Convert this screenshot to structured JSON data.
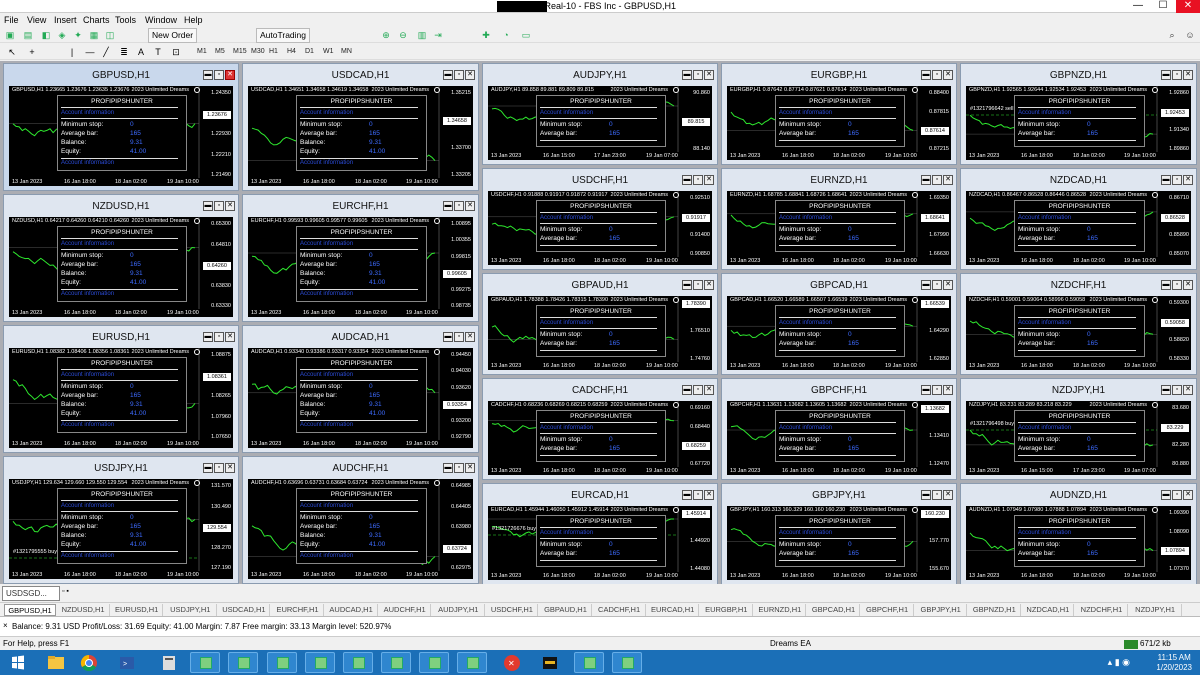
{
  "window": {
    "title": "FBS-Real-10 - FBS Inc - GBPUSD,H1",
    "min": "—",
    "max": "☐",
    "close": "✕"
  },
  "menu": [
    "File",
    "View",
    "Insert",
    "Charts",
    "Tools",
    "Window",
    "Help"
  ],
  "toolbar": {
    "new_order": "New Order",
    "autotrading": "AutoTrading",
    "timeframes": [
      "M1",
      "M5",
      "M15",
      "M30",
      "H1",
      "H4",
      "D1",
      "W1",
      "MN"
    ]
  },
  "ea": {
    "name": "PROFIPIPSHUNTER",
    "min_stop": "Minimum stop:",
    "avg_bar": "Average bar:",
    "balance": "Balance:",
    "equity": "Equity:",
    "link": "Account information",
    "dreams": "2023 Unlimited Dreams"
  },
  "charts": [
    {
      "title": "GBPUSD,H1",
      "header": "GBPUSD,H1  1.23665 1.23676 1.23635 1.23676",
      "prices": [
        "1.24350",
        "1.23676",
        "1.22930",
        "1.22210",
        "1.21490"
      ],
      "cur": "1.23676",
      "dates": [
        "13 Jan 2023",
        "16 Jan 18:00",
        "18 Jan 02:00",
        "19 Jan 10:00"
      ],
      "rows": 4,
      "active": true,
      "order": ""
    },
    {
      "title": "USDCAD,H1",
      "header": "USDCAD,H1  1.34651 1.34658 1.34619 1.34658",
      "prices": [
        "1.35215",
        "1.34658",
        "1.33700",
        "1.33205"
      ],
      "cur": "1.34658",
      "dates": [
        "13 Jan 2023",
        "16 Jan 18:00",
        "18 Jan 02:00",
        "19 Jan 10:00"
      ],
      "rows": 4,
      "order": ""
    },
    {
      "title": "AUDJPY,H1",
      "header": "AUDJPY,H1  89.858 89.881 89.809 89.815",
      "prices": [
        "90.860",
        "89.815",
        "88.140"
      ],
      "cur": "89.815",
      "dates": [
        "13 Jan 2023",
        "16 Jan 15:00",
        "17 Jan 23:00",
        "19 Jan 07:00"
      ],
      "rows": 2,
      "order": ""
    },
    {
      "title": "EURGBP,H1",
      "header": "EURGBP,H1  0.87642 0.87714 0.87621 0.87614",
      "prices": [
        "0.88400",
        "0.87815",
        "0.87614",
        "0.87215"
      ],
      "cur": "0.87614",
      "dates": [
        "13 Jan 2023",
        "16 Jan 18:00",
        "18 Jan 02:00",
        "19 Jan 10:00"
      ],
      "rows": 2,
      "order": ""
    },
    {
      "title": "GBPNZD,H1",
      "header": "GBPNZD,H1  1.92565 1.92644 1.92534 1.92453",
      "prices": [
        "1.92860",
        "1.92453",
        "1.91340",
        "1.89860"
      ],
      "cur": "1.92453",
      "dates": [
        "13 Jan 2023",
        "16 Jan 18:00",
        "18 Jan 02:00",
        "19 Jan 10:00"
      ],
      "rows": 2,
      "order": "#1321796642 sell 0.01"
    },
    {
      "title": "NZDUSD,H1",
      "header": "NZDUSD,H1  0.64217 0.64260 0.64210 0.64260",
      "prices": [
        "0.65300",
        "0.64810",
        "0.64260",
        "0.63830",
        "0.63330"
      ],
      "cur": "0.64260",
      "dates": [
        "13 Jan 2023",
        "16 Jan 18:00",
        "18 Jan 02:00",
        "19 Jan 10:00"
      ],
      "rows": 4,
      "order": ""
    },
    {
      "title": "EURCHF,H1",
      "header": "EURCHF,H1  0.99593 0.99605 0.99577 0.99605",
      "prices": [
        "1.00895",
        "1.00355",
        "0.99815",
        "0.99605",
        "0.99275",
        "0.98735"
      ],
      "cur": "0.99605",
      "dates": [
        "13 Jan 2023",
        "16 Jan 18:00",
        "18 Jan 02:00",
        "19 Jan 10:00"
      ],
      "rows": 4,
      "order": ""
    },
    {
      "title": "USDCHF,H1",
      "header": "USDCHF,H1  0.91888 0.91917 0.91872 0.91917",
      "prices": [
        "0.92510",
        "0.91917",
        "0.91400",
        "0.90850"
      ],
      "cur": "0.91917",
      "dates": [
        "13 Jan 2023",
        "16 Jan 18:00",
        "18 Jan 02:00",
        "19 Jan 10:00"
      ],
      "rows": 2,
      "order": ""
    },
    {
      "title": "EURNZD,H1",
      "header": "EURNZD,H1  1.68785 1.68841 1.68726 1.68641",
      "prices": [
        "1.69350",
        "1.68641",
        "1.67990",
        "1.66630"
      ],
      "cur": "1.68641",
      "dates": [
        "13 Jan 2023",
        "16 Jan 18:00",
        "18 Jan 02:00",
        "19 Jan 10:00"
      ],
      "rows": 2,
      "order": ""
    },
    {
      "title": "NZDCAD,H1",
      "header": "NZDCAD,H1  0.86467 0.86528 0.86446 0.86528",
      "prices": [
        "0.86710",
        "0.86528",
        "0.85890",
        "0.85070"
      ],
      "cur": "0.86528",
      "dates": [
        "13 Jan 2023",
        "16 Jan 18:00",
        "18 Jan 02:00",
        "19 Jan 10:00"
      ],
      "rows": 2,
      "order": ""
    },
    {
      "title": "EURUSD,H1",
      "header": "EURUSD,H1  1.08382 1.08406 1.08356 1.08361",
      "prices": [
        "1.08875",
        "1.08361",
        "1.08265",
        "1.07960",
        "1.07650"
      ],
      "cur": "1.08361",
      "dates": [
        "13 Jan 2023",
        "16 Jan 18:00",
        "18 Jan 02:00",
        "19 Jan 10:00"
      ],
      "rows": 4,
      "order": ""
    },
    {
      "title": "AUDCAD,H1",
      "header": "AUDCAD,H1  0.93340 0.93386 0.93317 0.93354",
      "prices": [
        "0.94450",
        "0.94030",
        "0.93620",
        "0.93354",
        "0.93200",
        "0.92790"
      ],
      "cur": "0.93354",
      "dates": [
        "13 Jan 2023",
        "16 Jan 18:00",
        "18 Jan 02:00",
        "19 Jan 10:00"
      ],
      "rows": 4,
      "order": ""
    },
    {
      "title": "GBPAUD,H1",
      "header": "GBPAUD,H1  1.78388 1.78426 1.78315 1.78390",
      "prices": [
        "1.78390",
        "1.76510",
        "1.74760"
      ],
      "cur": "1.78390",
      "dates": [
        "13 Jan 2023",
        "16 Jan 18:00",
        "18 Jan 02:00",
        "19 Jan 10:00"
      ],
      "rows": 2,
      "order": ""
    },
    {
      "title": "GBPCAD,H1",
      "header": "GBPCAD,H1  1.66520 1.66589 1.66507 1.66539",
      "prices": [
        "1.66539",
        "1.64290",
        "1.62850"
      ],
      "cur": "1.66539",
      "dates": [
        "13 Jan 2023",
        "16 Jan 18:00",
        "18 Jan 02:00",
        "19 Jan 10:00"
      ],
      "rows": 2,
      "order": ""
    },
    {
      "title": "NZDCHF,H1",
      "header": "NZDCHF,H1  0.59001 0.59064 0.58996 0.59058",
      "prices": [
        "0.59300",
        "0.59058",
        "0.58820",
        "0.58330"
      ],
      "cur": "0.59058",
      "dates": [
        "13 Jan 2023",
        "16 Jan 18:00",
        "18 Jan 02:00",
        "19 Jan 10:00"
      ],
      "rows": 2,
      "order": ""
    },
    {
      "title": "CADCHF,H1",
      "header": "CADCHF,H1  0.68236 0.68269 0.68215 0.68259",
      "prices": [
        "0.69160",
        "0.68440",
        "0.68259",
        "0.67720"
      ],
      "cur": "0.68259",
      "dates": [
        "13 Jan 2023",
        "16 Jan 18:00",
        "18 Jan 02:00",
        "19 Jan 10:00"
      ],
      "rows": 2,
      "order": ""
    },
    {
      "title": "GBPCHF,H1",
      "header": "GBPCHF,H1  1.13631 1.13682 1.13605 1.13682",
      "prices": [
        "1.13682",
        "1.13410",
        "1.12470"
      ],
      "cur": "1.13682",
      "dates": [
        "13 Jan 2023",
        "16 Jan 18:00",
        "18 Jan 02:00",
        "19 Jan 10:00"
      ],
      "rows": 2,
      "order": ""
    },
    {
      "title": "NZDJPY,H1",
      "header": "NZDJPY,H1  83.231 83.289 83.218 83.229",
      "prices": [
        "83.680",
        "83.229",
        "82.280",
        "80.880"
      ],
      "cur": "83.229",
      "dates": [
        "13 Jan 2023",
        "16 Jan 15:00",
        "17 Jan 23:00",
        "19 Jan 07:00"
      ],
      "rows": 2,
      "order": "#1321796498 buy 0.01"
    },
    {
      "title": "USDJPY,H1",
      "header": "USDJPY,H1  129.634 129.660 129.550 129.554",
      "prices": [
        "131.570",
        "130.490",
        "129.554",
        "128.270",
        "127.190"
      ],
      "cur": "129.554",
      "dates": [
        "13 Jan 2023",
        "16 Jan 18:00",
        "18 Jan 02:00",
        "19 Jan 10:00"
      ],
      "rows": 4,
      "order": "#1321795555 buy 0.01"
    },
    {
      "title": "AUDCHF,H1",
      "header": "AUDCHF,H1  0.63696 0.63731 0.63684 0.63724",
      "prices": [
        "0.64985",
        "0.64405",
        "0.63980",
        "0.63724",
        "0.62975"
      ],
      "cur": "0.63724",
      "dates": [
        "13 Jan 2023",
        "16 Jan 18:00",
        "18 Jan 02:00",
        "19 Jan 10:00"
      ],
      "rows": 4,
      "order": ""
    },
    {
      "title": "EURCAD,H1",
      "header": "EURCAD,H1  1.45944 1.46050 1.45912 1.45914",
      "prices": [
        "1.45914",
        "1.44920",
        "1.44080"
      ],
      "cur": "1.45914",
      "dates": [
        "13 Jan 2023",
        "16 Jan 18:00",
        "18 Jan 02:00",
        "19 Jan 10:00"
      ],
      "rows": 2,
      "order": "#1321726676 buy 0.01"
    },
    {
      "title": "GBPJPY,H1",
      "header": "GBPJPY,H1  160.313 160.329 160.160 160.230",
      "prices": [
        "160.230",
        "157.770",
        "155.670"
      ],
      "cur": "160.230",
      "dates": [
        "13 Jan 2023",
        "16 Jan 18:00",
        "18 Jan 02:00",
        "19 Jan 10:00"
      ],
      "rows": 2,
      "order": ""
    },
    {
      "title": "AUDNZD,H1",
      "header": "AUDNZD,H1  1.07949 1.07980 1.07888 1.07894",
      "prices": [
        "1.09390",
        "1.08090",
        "1.07894",
        "1.07370"
      ],
      "cur": "1.07894",
      "dates": [
        "13 Jan 2023",
        "16 Jan 18:00",
        "18 Jan 02:00",
        "19 Jan 10:00"
      ],
      "rows": 2,
      "order": ""
    }
  ],
  "values": {
    "min_stop": "0",
    "avg_bar": "165",
    "balance": "9.31",
    "equity": "41.00"
  },
  "dock": {
    "label": "USDSGD..."
  },
  "tabs": [
    "GBPUSD,H1",
    "NZDUSD,H1",
    "EURUSD,H1",
    "USDJPY,H1",
    "USDCAD,H1",
    "EURCHF,H1",
    "AUDCAD,H1",
    "AUDCHF,H1",
    "AUDJPY,H1",
    "USDCHF,H1",
    "GBPAUD,H1",
    "CADCHF,H1",
    "EURCAD,H1",
    "EURGBP,H1",
    "EURNZD,H1",
    "GBPCAD,H1",
    "GBPCHF,H1",
    "GBPJPY,H1",
    "GBPNZD,H1",
    "NZDCAD,H1",
    "NZDCHF,H1",
    "NZDJPY,H1"
  ],
  "account": "Balance: 9.31 USD  Profit/Loss: 31.69  Equity: 41.00  Margin: 7.87  Free margin: 33.13  Margin level: 520.97%",
  "status": {
    "help": "For Help, press F1",
    "ea": "Dreams EA",
    "traffic": "671/2 kb"
  },
  "clock": {
    "time": "11:15 AM",
    "date": "1/20/2023"
  }
}
